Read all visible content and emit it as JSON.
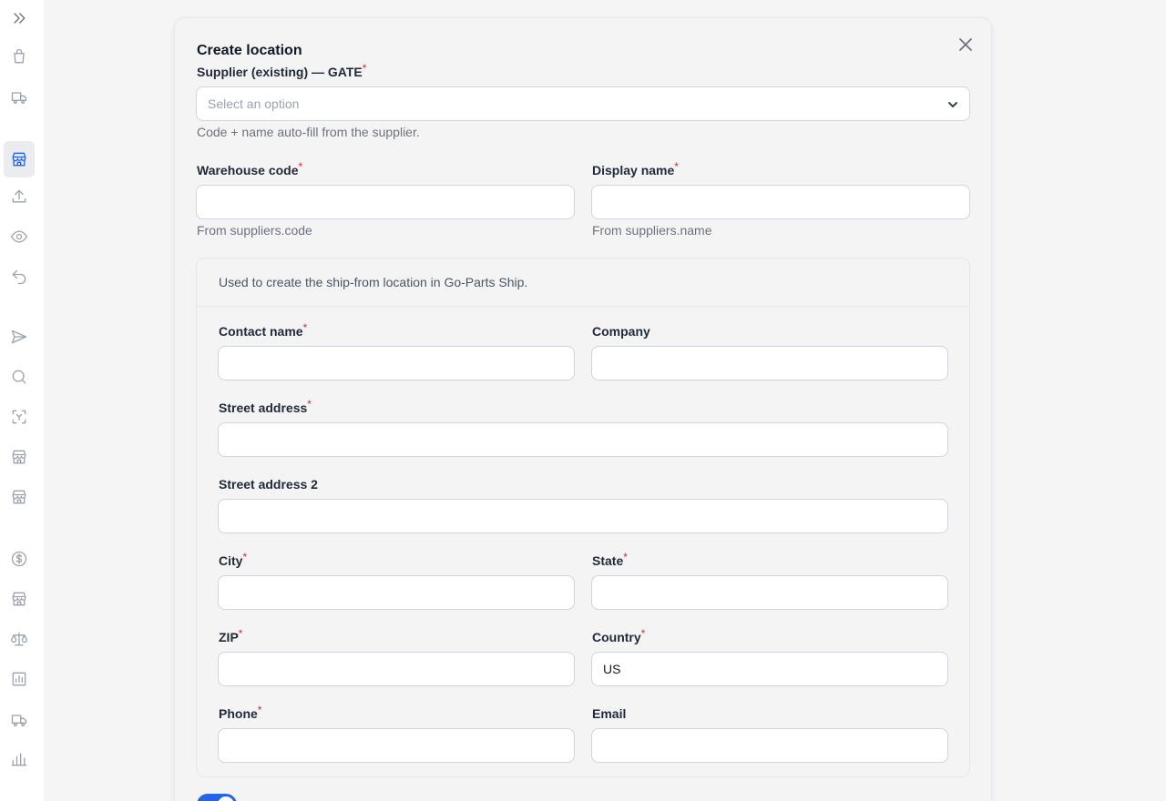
{
  "sidebar": {
    "items": [
      {
        "icon": "chevrons-right-icon"
      },
      {
        "icon": "shopping-bag-icon"
      },
      {
        "icon": "truck-icon"
      },
      {
        "icon": "store-icon",
        "active": true
      },
      {
        "icon": "upload-icon"
      },
      {
        "icon": "eye-icon"
      },
      {
        "icon": "undo-icon"
      },
      {
        "icon": "send-icon"
      },
      {
        "icon": "search-icon"
      },
      {
        "icon": "scan-icon"
      },
      {
        "icon": "store-icon"
      },
      {
        "icon": "store-icon"
      },
      {
        "icon": "dollar-icon"
      },
      {
        "icon": "store-icon"
      },
      {
        "icon": "scale-icon"
      },
      {
        "icon": "chart-icon"
      },
      {
        "icon": "truck-icon"
      },
      {
        "icon": "bar-chart-icon"
      }
    ]
  },
  "modal": {
    "title": "Create location",
    "supplier": {
      "label": "Supplier (existing) — GATE",
      "placeholder": "Select an option",
      "hint": "Code + name auto-fill from the supplier."
    },
    "warehouse_code": {
      "label": "Warehouse code",
      "value": "",
      "hint": "From suppliers.code"
    },
    "display_name": {
      "label": "Display name",
      "value": "",
      "hint": "From suppliers.name"
    },
    "address_section": {
      "description": "Used to create the ship-from location in Go-Parts Ship.",
      "contact_name": {
        "label": "Contact name",
        "value": ""
      },
      "company": {
        "label": "Company",
        "value": ""
      },
      "street_address": {
        "label": "Street address",
        "value": ""
      },
      "street_address_2": {
        "label": "Street address 2",
        "value": ""
      },
      "city": {
        "label": "City",
        "value": ""
      },
      "state": {
        "label": "State",
        "value": ""
      },
      "zip": {
        "label": "ZIP",
        "value": ""
      },
      "country": {
        "label": "Country",
        "value": "US"
      },
      "phone": {
        "label": "Phone",
        "value": ""
      },
      "email": {
        "label": "Email",
        "value": ""
      }
    },
    "toggle": {
      "on": true
    },
    "required_marker": "*"
  },
  "colors": {
    "accent": "#2563eb",
    "required": "#dc2626",
    "background": "#f5f5f6"
  }
}
